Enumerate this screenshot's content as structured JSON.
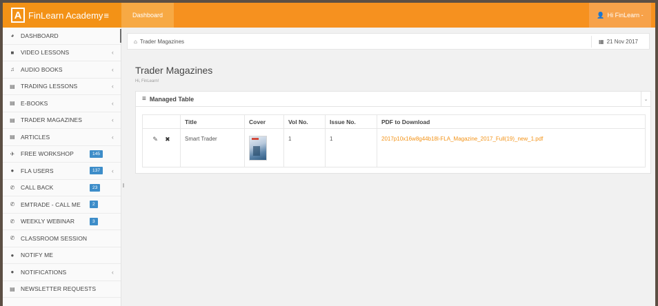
{
  "brand": {
    "logo_letter": "A",
    "name": "FinLearn Academy"
  },
  "topbar": {
    "dashboard_label": "Dashboard",
    "user_label": "Hi FinLearn -"
  },
  "sidebar": {
    "items": [
      {
        "label": "DASHBOARD",
        "icon": "dashboard-icon",
        "active": true
      },
      {
        "label": "VIDEO LESSONS",
        "icon": "video-icon",
        "chevron": true
      },
      {
        "label": "AUDIO BOOKS",
        "icon": "music-icon",
        "chevron": true
      },
      {
        "label": "TRADING LESSONS",
        "icon": "book-icon",
        "chevron": true
      },
      {
        "label": "E-BOOKS",
        "icon": "book-icon",
        "chevron": true
      },
      {
        "label": "TRADER MAGAZINES",
        "icon": "book-icon",
        "chevron": true
      },
      {
        "label": "ARTICLES",
        "icon": "book-icon",
        "chevron": true
      },
      {
        "label": "FREE WORKSHOP",
        "icon": "plane-icon",
        "badge": "145"
      },
      {
        "label": "FLA USERS",
        "icon": "user-icon",
        "badge": "137",
        "chevron": true
      },
      {
        "label": "CALL BACK",
        "icon": "phone-icon",
        "badge": "23"
      },
      {
        "label": "EMTRADE - CALL ME",
        "icon": "phone-icon",
        "badge": "2"
      },
      {
        "label": "WEEKLY WEBINAR",
        "icon": "phone-icon",
        "badge": "3"
      },
      {
        "label": "CLASSROOM SESSION",
        "icon": "phone-icon"
      },
      {
        "label": "NOTIFY ME",
        "icon": "comment-icon"
      },
      {
        "label": "NOTIFICATIONS",
        "icon": "comment-icon",
        "chevron": true
      },
      {
        "label": "NEWSLETTER REQUESTS",
        "icon": "file-icon"
      }
    ]
  },
  "breadcrumb": {
    "current": "Trader Magazines",
    "date": "21 Nov 2017"
  },
  "page": {
    "title": "Trader Magazines",
    "subtitle": "Hi, FinLearn!"
  },
  "panel": {
    "title": "Managed Table"
  },
  "table": {
    "columns": [
      "",
      "Title",
      "Cover",
      "Vol No.",
      "Issue No.",
      "PDF to Download"
    ],
    "rows": [
      {
        "title": "Smart Trader",
        "vol": "1",
        "issue": "1",
        "pdf": "2017p10x16w8g44b18l-FLA_Magazine_2017_Full(19)_new_1.pdf"
      }
    ]
  },
  "colors": {
    "topbar": "#f6911f",
    "brand_bg": "#f39216",
    "badge": "#3d8dc9",
    "link": "#f39216"
  }
}
